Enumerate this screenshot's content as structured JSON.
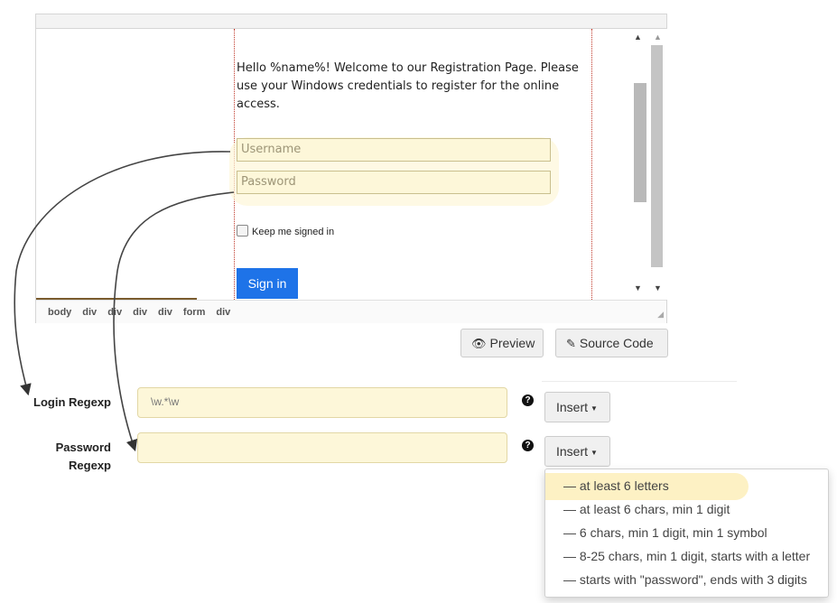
{
  "editor": {
    "welcome_text": "Hello %name%! Welcome to our Registration Page. Please use your Windows credentials to register for the online access.",
    "username_placeholder": "Username",
    "password_placeholder": "Password",
    "keep_signed_in": "Keep me signed in",
    "sign_in": "Sign in",
    "path": [
      "body",
      "div",
      "div",
      "div",
      "div",
      "form",
      "div"
    ]
  },
  "toolbar": {
    "preview": "Preview",
    "source_code": "Source Code"
  },
  "form": {
    "login_label": "Login Regexp",
    "password_label_1": "Password",
    "password_label_2": "Regexp",
    "login_value": "\\w.*\\w",
    "password_value": "",
    "insert": "Insert"
  },
  "menu": {
    "items": [
      "— at least 6 letters",
      "— at least 6 chars, min 1 digit",
      "— 6 chars, min 1 digit, min 1 symbol",
      "— 8-25 chars, min 1 digit, starts with a letter",
      "— starts with \"password\", ends with 3 digits"
    ]
  },
  "colors": {
    "field_bg": "#fdf7d9",
    "highlight": "#fdf1c4",
    "primary": "#1e73e8",
    "guide": "#c0392b"
  }
}
